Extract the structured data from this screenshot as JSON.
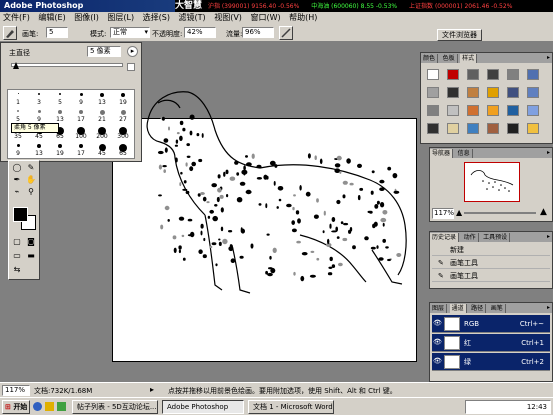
{
  "app": {
    "title": "Adobe Photoshop"
  },
  "ticker": {
    "logo": "大智慧",
    "items": [
      "沪指 (399001) 9156.40 -0.56%",
      "中海油 (600060) 8.55 -0.53%",
      "上证指数 (000001) 2061.46 -0.52%"
    ]
  },
  "menu": [
    "文件(F)",
    "编辑(E)",
    "图像(I)",
    "图层(L)",
    "选择(S)",
    "滤镜(T)",
    "视图(V)",
    "窗口(W)",
    "帮助(H)"
  ],
  "options": {
    "brush_label": "画笔:",
    "brush_size": "5",
    "mode_label": "模式:",
    "mode_value": "正常",
    "opacity_label": "不透明度:",
    "opacity_value": "42%",
    "flow_label": "流量:",
    "flow_value": "96%",
    "file_browser_tab": "文件浏览器"
  },
  "brush_picker": {
    "diameter_label": "主直径",
    "diameter_value": "5 像素",
    "tooltip": "柔角 5 像素",
    "sizes": [
      "1",
      "3",
      "5",
      "9",
      "13",
      "19",
      "5",
      "9",
      "13",
      "17",
      "21",
      "27",
      "35",
      "45",
      "65",
      "100",
      "200",
      "300",
      "9",
      "13",
      "19",
      "17",
      "45",
      "65"
    ]
  },
  "styles_panel": {
    "tabs": [
      "颜色",
      "色板",
      "样式"
    ],
    "swatch_colors": [
      "#ffffff",
      "#c00000",
      "#606060",
      "#404040",
      "#808080",
      "#5070b0",
      "#a0a0a0",
      "#303030",
      "#c08040",
      "#e0a000",
      "#405080",
      "#6080c0",
      "#808080",
      "#c0c0c0",
      "#d07030",
      "#f0a020",
      "#2060a0",
      "#80a0e0",
      "#303030",
      "#e0d0a0",
      "#4080c0",
      "#a06040",
      "#202020",
      "#f0c040"
    ]
  },
  "navigator_panel": {
    "tabs": [
      "导航器",
      "信息"
    ],
    "zoom": "117%"
  },
  "history_panel": {
    "tabs": [
      "历史记录",
      "动作",
      "工具预设"
    ],
    "rows": [
      "新建",
      "画笔工具",
      "画笔工具"
    ]
  },
  "channels_panel": {
    "tabs": [
      "图层",
      "通道",
      "路径",
      "画笔"
    ],
    "rows": [
      {
        "name": "RGB",
        "shortcut": "Ctrl+~"
      },
      {
        "name": "红",
        "shortcut": "Ctrl+1"
      },
      {
        "name": "绿",
        "shortcut": "Ctrl+2"
      }
    ]
  },
  "status": {
    "zoom": "117%",
    "doc": "文档:732K/1.68M",
    "hint": "点按并拖移以用前景色绘画。要用附加选项，使用 Shift、Alt 和 Ctrl 键。"
  },
  "taskbar": {
    "start": "开始",
    "buttons": [
      "帖子列表 - 5D互动论坛...",
      "Adobe Photoshop",
      "文档 1 - Microsoft Word"
    ],
    "clock": "12:43"
  }
}
